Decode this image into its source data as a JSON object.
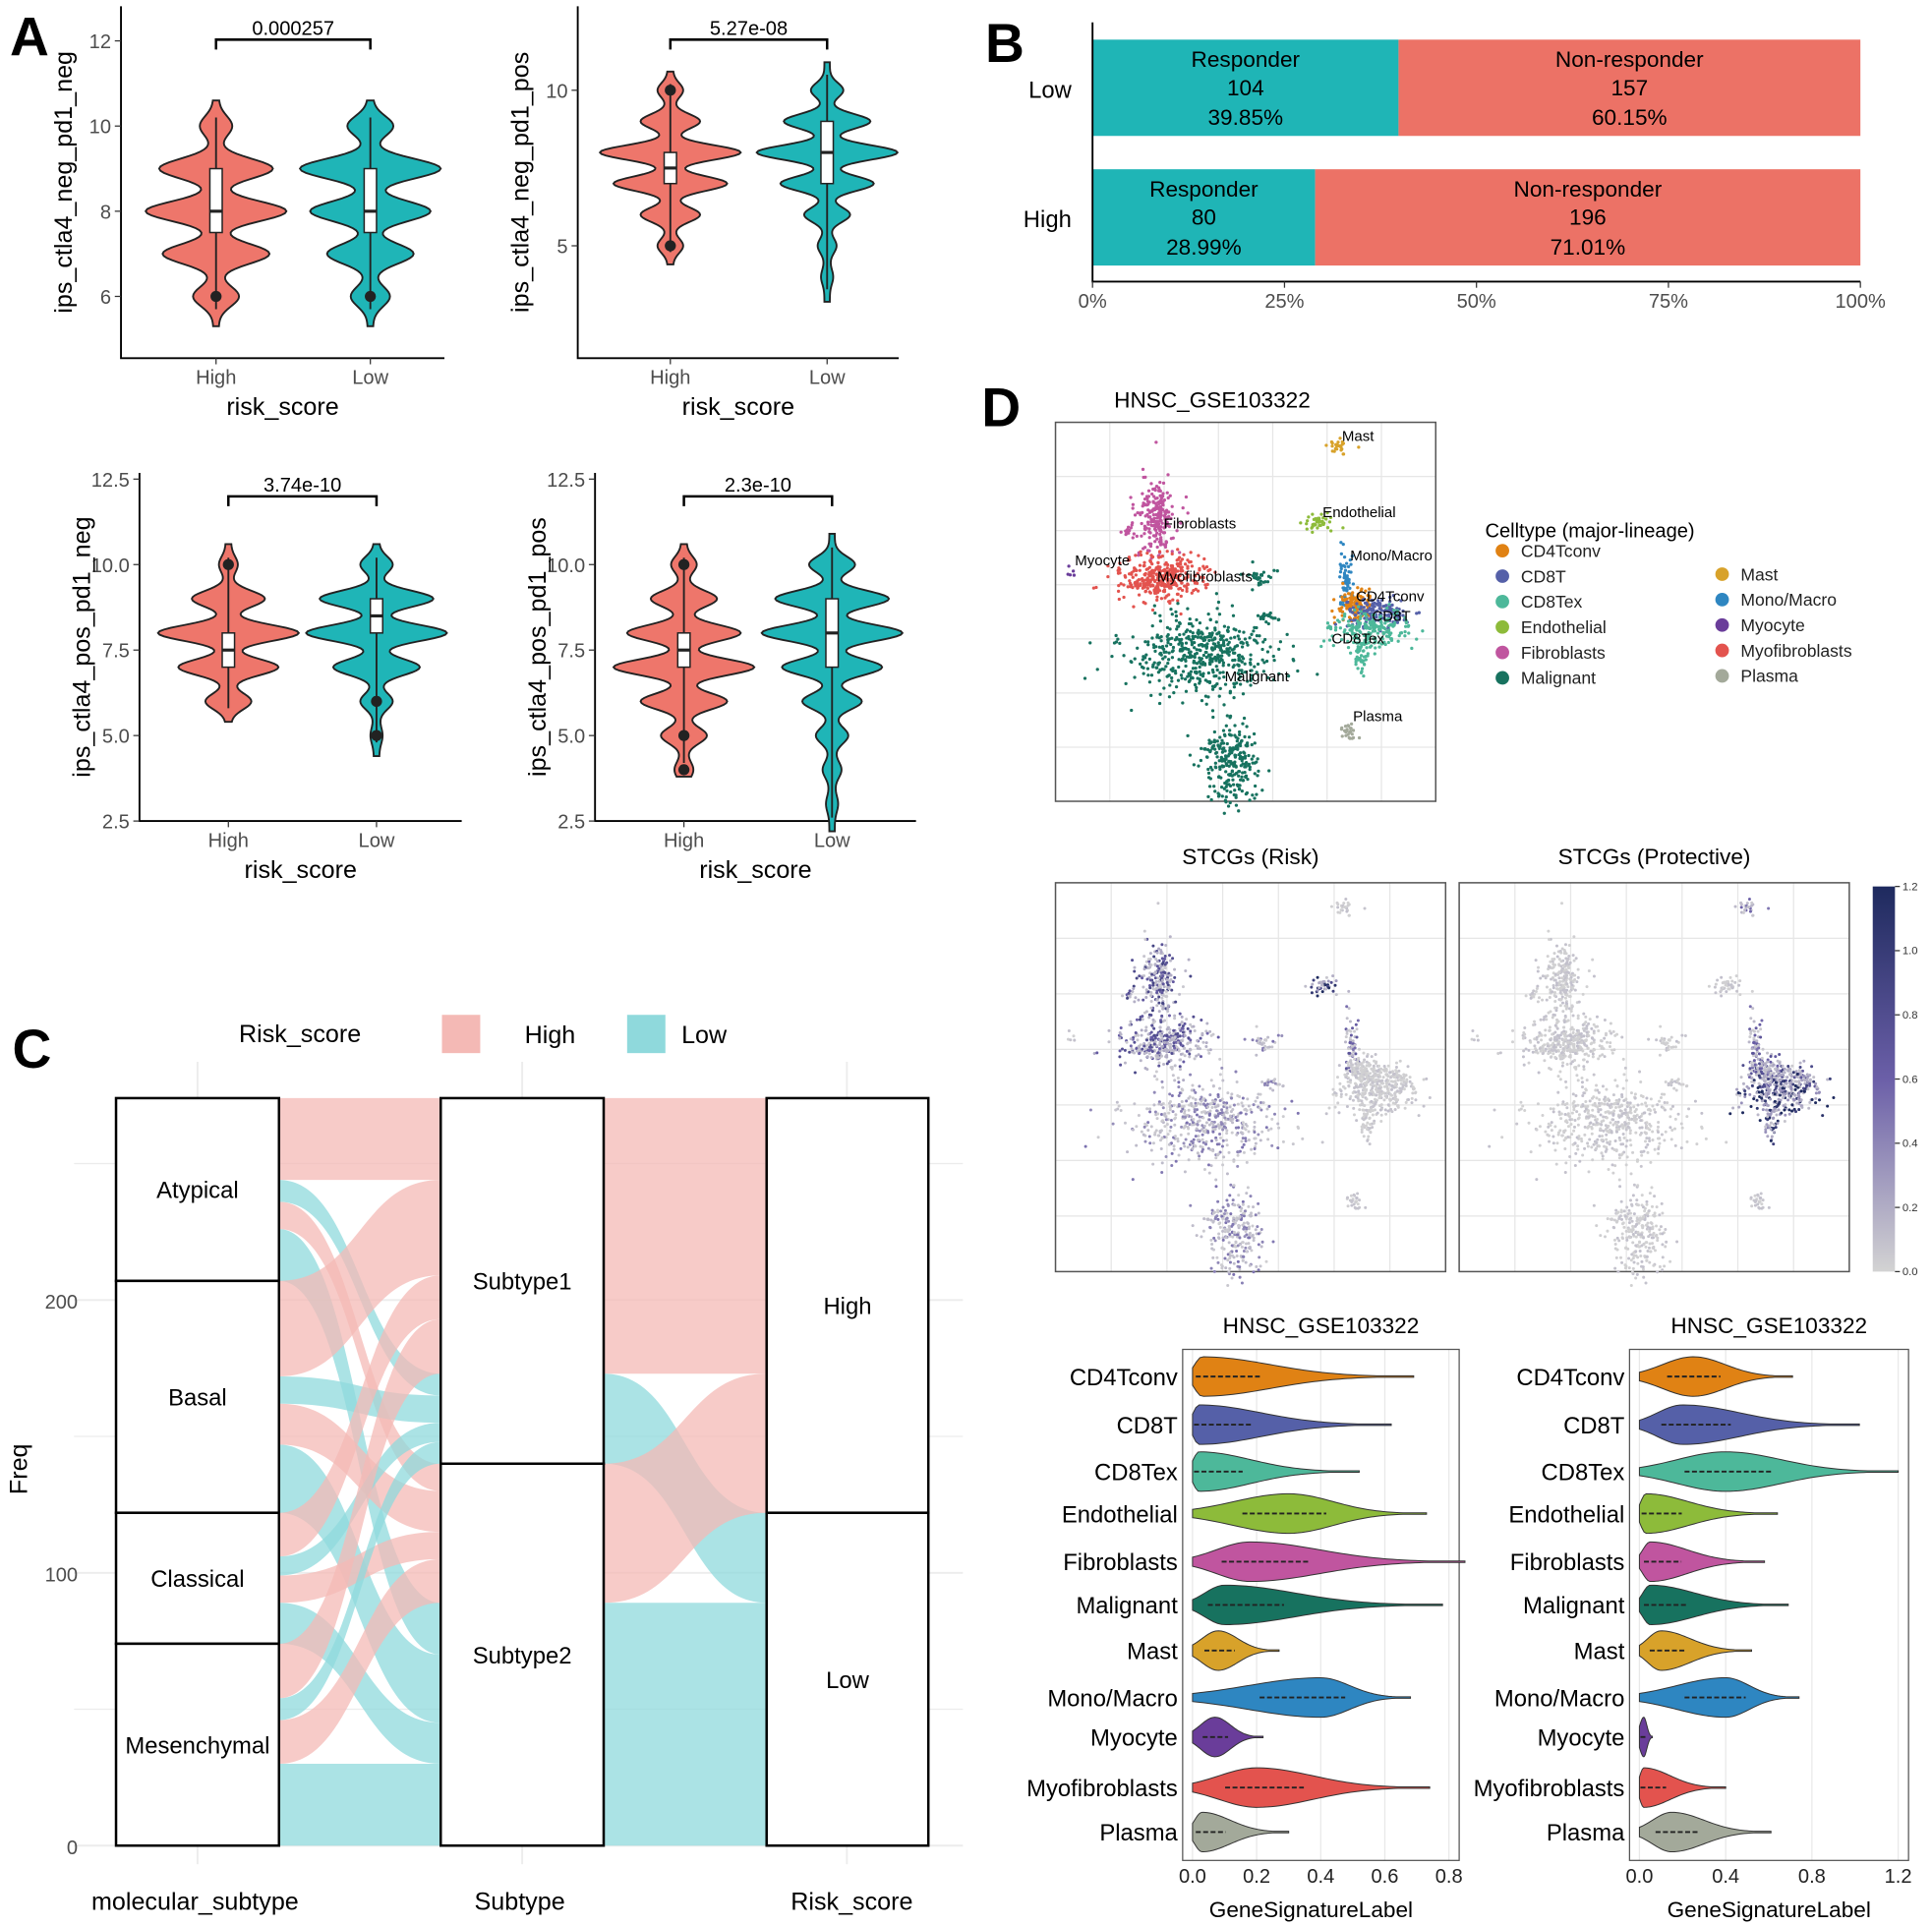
{
  "panel_labels": {
    "a": "A",
    "b": "B",
    "c": "C",
    "d": "D"
  },
  "colors": {
    "high": "#EE766B",
    "low": "#1FB5B7",
    "high_light": "#F4B9B5",
    "low_light": "#8FD9DC",
    "responder": "#1FB5B6",
    "non_responder": "#EC7266"
  },
  "chart_data": [
    {
      "id": "A1",
      "type": "violin",
      "ylabel": "ips_ctla4_neg_pd1_neg",
      "xlabel": "risk_score",
      "categories": [
        "High",
        "Low"
      ],
      "pvalue": "0.000257",
      "yticks": [
        "6",
        "8",
        "10",
        "12"
      ],
      "ytick_values": [
        6,
        8,
        10,
        12
      ],
      "ylim": [
        4.55,
        12.8
      ],
      "groups": [
        {
          "min": 5.3,
          "max": 10.6,
          "q1": 7.5,
          "median": 8,
          "q3": 9,
          "outliers": [
            6
          ],
          "modes": [
            [
              6,
              0.3
            ],
            [
              7,
              0.75
            ],
            [
              8,
              1
            ],
            [
              9,
              0.8
            ],
            [
              10,
              0.2
            ]
          ]
        },
        {
          "min": 5.3,
          "max": 10.6,
          "q1": 7.5,
          "median": 8,
          "q3": 9,
          "outliers": [
            6
          ],
          "modes": [
            [
              6,
              0.25
            ],
            [
              7,
              0.6
            ],
            [
              8,
              0.85
            ],
            [
              9,
              1
            ],
            [
              10,
              0.3
            ]
          ]
        }
      ]
    },
    {
      "id": "A2",
      "type": "violin",
      "ylabel": "ips_ctla4_neg_pd1_pos",
      "xlabel": "risk_score",
      "categories": [
        "High",
        "Low"
      ],
      "pvalue": "5.27e-08",
      "yticks": [
        "5",
        "10"
      ],
      "ytick_values": [
        5,
        10
      ],
      "ylim": [
        1.4,
        12.7
      ],
      "groups": [
        {
          "min": 4.4,
          "max": 10.6,
          "q1": 7,
          "median": 7.5,
          "q3": 8,
          "outliers": [
            5,
            10
          ],
          "modes": [
            [
              5,
              0.15
            ],
            [
              6,
              0.4
            ],
            [
              7,
              0.8
            ],
            [
              8,
              1
            ],
            [
              9,
              0.4
            ],
            [
              10,
              0.15
            ]
          ]
        },
        {
          "min": 3.2,
          "max": 10.9,
          "q1": 7,
          "median": 8,
          "q3": 9,
          "outliers": [],
          "modes": [
            [
              4,
              0.05
            ],
            [
              5,
              0.1
            ],
            [
              6,
              0.3
            ],
            [
              7,
              0.65
            ],
            [
              8,
              1
            ],
            [
              9,
              0.6
            ],
            [
              10,
              0.2
            ]
          ]
        }
      ]
    },
    {
      "id": "A3",
      "type": "violin",
      "ylabel": "ips_ctla4_pos_pd1_neg",
      "xlabel": "risk_score",
      "categories": [
        "High",
        "Low"
      ],
      "pvalue": "3.74e-10",
      "yticks": [
        "2.5",
        "5.0",
        "7.5",
        "10.0",
        "12.5"
      ],
      "ytick_values": [
        2.5,
        5,
        7.5,
        10,
        12.5
      ],
      "ylim": [
        2.5,
        12.7
      ],
      "groups": [
        {
          "min": 5.4,
          "max": 10.6,
          "q1": 7,
          "median": 7.5,
          "q3": 8,
          "outliers": [
            10
          ],
          "modes": [
            [
              6,
              0.3
            ],
            [
              7,
              0.7
            ],
            [
              8,
              1
            ],
            [
              9,
              0.5
            ],
            [
              10,
              0.1
            ]
          ]
        },
        {
          "min": 4.4,
          "max": 10.6,
          "q1": 8,
          "median": 8.5,
          "q3": 9,
          "outliers": [
            5,
            6
          ],
          "modes": [
            [
              5,
              0.05
            ],
            [
              6,
              0.2
            ],
            [
              7,
              0.6
            ],
            [
              8,
              1
            ],
            [
              9,
              0.8
            ],
            [
              10,
              0.2
            ]
          ]
        }
      ]
    },
    {
      "id": "A4",
      "type": "violin",
      "ylabel": "ips_ctla4_pos_pd1_pos",
      "xlabel": "risk_score",
      "categories": [
        "High",
        "Low"
      ],
      "pvalue": "2.3e-10",
      "yticks": [
        "2.5",
        "5.0",
        "7.5",
        "10.0",
        "12.5"
      ],
      "ytick_values": [
        2.5,
        5,
        7.5,
        10,
        12.5
      ],
      "ylim": [
        2.5,
        12.7
      ],
      "groups": [
        {
          "min": 3.8,
          "max": 10.6,
          "q1": 7,
          "median": 7.5,
          "q3": 8,
          "outliers": [
            4,
            5,
            10
          ],
          "modes": [
            [
              4,
              0.1
            ],
            [
              5,
              0.3
            ],
            [
              6,
              0.6
            ],
            [
              7,
              1
            ],
            [
              8,
              0.8
            ],
            [
              9,
              0.45
            ],
            [
              10,
              0.15
            ]
          ]
        },
        {
          "min": 2.2,
          "max": 10.9,
          "q1": 7,
          "median": 8,
          "q3": 9,
          "outliers": [],
          "modes": [
            [
              3,
              0.05
            ],
            [
              4,
              0.1
            ],
            [
              5,
              0.2
            ],
            [
              6,
              0.4
            ],
            [
              7,
              0.7
            ],
            [
              8,
              1
            ],
            [
              9,
              0.8
            ],
            [
              10,
              0.3
            ]
          ]
        }
      ]
    },
    {
      "id": "B",
      "type": "bar",
      "stacked": true,
      "orientation": "horizontal",
      "categories": [
        "Low",
        "High"
      ],
      "xticks": [
        "0%",
        "25%",
        "50%",
        "75%",
        "100%"
      ],
      "series": [
        {
          "name": "Responder",
          "values": [
            104,
            80
          ],
          "percent_labels": [
            "39.85%",
            "28.99%"
          ],
          "percent": [
            39.85,
            28.99
          ]
        },
        {
          "name": "Non-responder",
          "values": [
            157,
            196
          ],
          "percent_labels": [
            "60.15%",
            "71.01%"
          ],
          "percent": [
            60.15,
            71.01
          ]
        }
      ]
    },
    {
      "id": "C",
      "type": "alluvial",
      "ylabel": "Freq",
      "yticks": [
        "0",
        "100",
        "200"
      ],
      "ytick_values": [
        0,
        100,
        200
      ],
      "ylim": [
        0,
        274
      ],
      "axes": [
        "molecular_subtype",
        "Subtype",
        "Risk_score"
      ],
      "legend": {
        "title": "Risk_score",
        "entries": [
          "High",
          "Low"
        ],
        "position": "top"
      },
      "strata": [
        [
          "Atypical",
          "Basal",
          "Classical",
          "Mesenchymal"
        ],
        [
          "Subtype1",
          "Subtype2"
        ],
        [
          "High",
          "Low"
        ]
      ],
      "flows": [
        {
          "molecular": "Atypical",
          "subtype": "Subtype1",
          "risk": "High",
          "n": 30
        },
        {
          "molecular": "Atypical",
          "subtype": "Subtype1",
          "risk": "Low",
          "n": 8
        },
        {
          "molecular": "Atypical",
          "subtype": "Subtype2",
          "risk": "High",
          "n": 10
        },
        {
          "molecular": "Atypical",
          "subtype": "Subtype2",
          "risk": "Low",
          "n": 19
        },
        {
          "molecular": "Basal",
          "subtype": "Subtype1",
          "risk": "High",
          "n": 35
        },
        {
          "molecular": "Basal",
          "subtype": "Subtype1",
          "risk": "Low",
          "n": 10
        },
        {
          "molecular": "Basal",
          "subtype": "Subtype2",
          "risk": "High",
          "n": 15
        },
        {
          "molecular": "Basal",
          "subtype": "Subtype2",
          "risk": "Low",
          "n": 25
        },
        {
          "molecular": "Classical",
          "subtype": "Subtype1",
          "risk": "High",
          "n": 16
        },
        {
          "molecular": "Classical",
          "subtype": "Subtype1",
          "risk": "Low",
          "n": 7
        },
        {
          "molecular": "Classical",
          "subtype": "Subtype2",
          "risk": "High",
          "n": 10
        },
        {
          "molecular": "Classical",
          "subtype": "Subtype2",
          "risk": "Low",
          "n": 15
        },
        {
          "molecular": "Mesenchymal",
          "subtype": "Subtype1",
          "risk": "High",
          "n": 20
        },
        {
          "molecular": "Mesenchymal",
          "subtype": "Subtype1",
          "risk": "Low",
          "n": 8
        },
        {
          "molecular": "Mesenchymal",
          "subtype": "Subtype2",
          "risk": "High",
          "n": 16
        },
        {
          "molecular": "Mesenchymal",
          "subtype": "Subtype2",
          "risk": "Low",
          "n": 30
        }
      ]
    },
    {
      "id": "D_umap",
      "type": "scatter",
      "title": "HNSC_GSE103322",
      "legend": {
        "title": "Celltype (major-lineage)",
        "position": "right",
        "entries": [
          {
            "name": "CD4Tconv",
            "color": "#E08214"
          },
          {
            "name": "CD8T",
            "color": "#5560A8"
          },
          {
            "name": "CD8Tex",
            "color": "#4DB89A"
          },
          {
            "name": "Endothelial",
            "color": "#8DBB3A"
          },
          {
            "name": "Fibroblasts",
            "color": "#C0559F"
          },
          {
            "name": "Malignant",
            "color": "#17725F"
          },
          {
            "name": "Mast",
            "color": "#D8A22A"
          },
          {
            "name": "Mono/Macro",
            "color": "#2E86C1"
          },
          {
            "name": "Myocyte",
            "color": "#6A3D9A"
          },
          {
            "name": "Myofibroblasts",
            "color": "#E3534E"
          },
          {
            "name": "Plasma",
            "color": "#A3A99A"
          }
        ]
      },
      "cluster_labels": [
        "Mast",
        "Endothelial",
        "Fibroblasts",
        "Myocyte",
        "Myofibroblasts",
        "Mono/Macro",
        "CD4Tconv",
        "CD8T",
        "CD8Tex",
        "Malignant",
        "Plasma"
      ]
    },
    {
      "id": "D_feature",
      "type": "scatter",
      "titles": [
        "STCGs (Risk)",
        "STCGs (Protective)"
      ],
      "colorbar": {
        "ticks": [
          "0.0",
          "0.2",
          "0.4",
          "0.6",
          "0.8",
          "1.0",
          "1.2"
        ],
        "range": [
          0,
          1.2
        ],
        "colors": [
          "#D3D3D3",
          "#6B5FA8",
          "#1E2A5E"
        ]
      }
    },
    {
      "id": "D_violin1",
      "type": "violin",
      "orientation": "horizontal",
      "title": "HNSC_GSE103322",
      "xlabel": "GeneSignatureLabel",
      "xticks": [
        "0.0",
        "0.2",
        "0.4",
        "0.6",
        "0.8"
      ],
      "xlim": [
        0,
        0.8
      ],
      "categories": [
        "CD4Tconv",
        "CD8T",
        "CD8Tex",
        "Endothelial",
        "Fibroblasts",
        "Malignant",
        "Mast",
        "Mono/Macro",
        "Myocyte",
        "Myofibroblasts",
        "Plasma"
      ],
      "max": [
        0.69,
        0.62,
        0.52,
        0.73,
        0.85,
        0.78,
        0.27,
        0.68,
        0.22,
        0.74,
        0.3
      ],
      "median": [
        0.03,
        0.02,
        0.02,
        0.3,
        0.18,
        0.1,
        0.08,
        0.4,
        0.07,
        0.2,
        0.03
      ]
    },
    {
      "id": "D_violin2",
      "type": "violin",
      "orientation": "horizontal",
      "title": "HNSC_GSE103322",
      "xlabel": "GeneSignatureLabel",
      "xticks": [
        "0.0",
        "0.4",
        "0.8",
        "1.2"
      ],
      "xlim": [
        0,
        1.2
      ],
      "categories": [
        "CD4Tconv",
        "CD8T",
        "CD8Tex",
        "Endothelial",
        "Fibroblasts",
        "Malignant",
        "Mast",
        "Mono/Macro",
        "Myocyte",
        "Myofibroblasts",
        "Plasma"
      ],
      "max": [
        0.71,
        1.02,
        1.2,
        0.64,
        0.58,
        0.69,
        0.52,
        0.74,
        0.06,
        0.4,
        0.61
      ],
      "median": [
        0.25,
        0.2,
        0.4,
        0.03,
        0.05,
        0.05,
        0.1,
        0.4,
        0.02,
        0.02,
        0.15
      ]
    }
  ]
}
